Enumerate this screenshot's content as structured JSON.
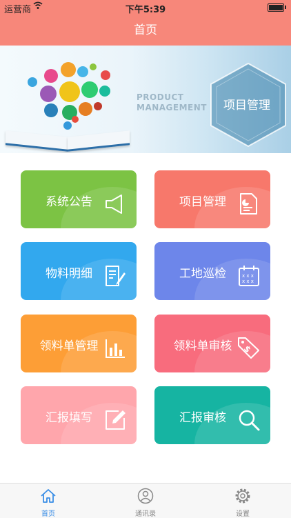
{
  "status_bar": {
    "carrier": "运营商",
    "time": "下午5:39"
  },
  "nav": {
    "title": "首页"
  },
  "banner": {
    "product_text_line1": "PRODUCT",
    "product_text_line2": "MANAGEMENT",
    "hex_label": "项目管理"
  },
  "tiles": [
    {
      "label": "系统公告",
      "color": "#7cc344",
      "icon": "speaker-icon"
    },
    {
      "label": "项目管理",
      "color": "#f7786b",
      "icon": "report-document-icon"
    },
    {
      "label": "物料明细",
      "color": "#32a8ee",
      "icon": "edit-document-icon"
    },
    {
      "label": "工地巡检",
      "color": "#6d86ea",
      "icon": "calendar-icon"
    },
    {
      "label": "领料单管理",
      "color": "#fd9e36",
      "icon": "bar-chart-icon"
    },
    {
      "label": "领料单审核",
      "color": "#f86c7d",
      "icon": "price-tag-icon"
    },
    {
      "label": "汇报填写",
      "color": "#ffa6ac",
      "icon": "write-icon"
    },
    {
      "label": "汇报审核",
      "color": "#16b4a2",
      "icon": "magnifier-icon"
    }
  ],
  "tab_bar": {
    "items": [
      {
        "label": "首页",
        "icon": "home-icon",
        "active": true
      },
      {
        "label": "通讯录",
        "icon": "contacts-icon",
        "active": false
      },
      {
        "label": "设置",
        "icon": "settings-icon",
        "active": false
      }
    ],
    "active_color": "#3a8ee6",
    "inactive_color": "#888888"
  }
}
